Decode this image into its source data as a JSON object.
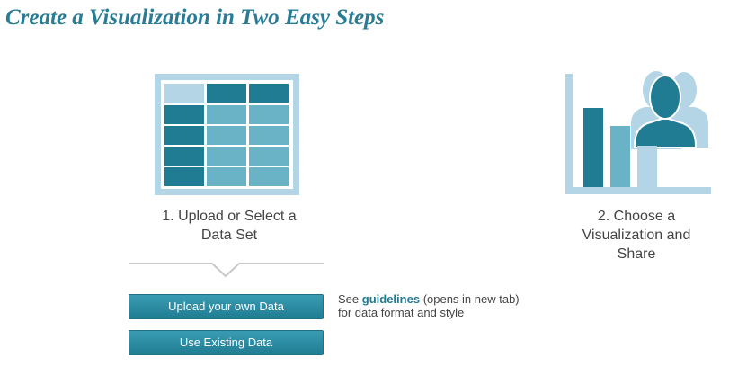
{
  "title": "Create a Visualization in Two Easy Steps",
  "step1": {
    "icon": "table-grid-icon",
    "label_line1": "1. Upload or Select a",
    "label_line2": "Data Set"
  },
  "step2": {
    "icon": "chart-people-icon",
    "label_line1": "2. Choose a",
    "label_line2": "Visualization and",
    "label_line3": "Share"
  },
  "buttons": {
    "upload": "Upload your own Data",
    "existing": "Use Existing Data"
  },
  "note": {
    "prefix": "See",
    "link": "guidelines",
    "link_suffix": "(opens in new tab)",
    "line2": "for data format and style"
  },
  "colors": {
    "title": "#2a7c95",
    "dark_teal": "#1f7c93",
    "mid_teal": "#6ab3c6",
    "light_blue": "#b3d5e6"
  }
}
